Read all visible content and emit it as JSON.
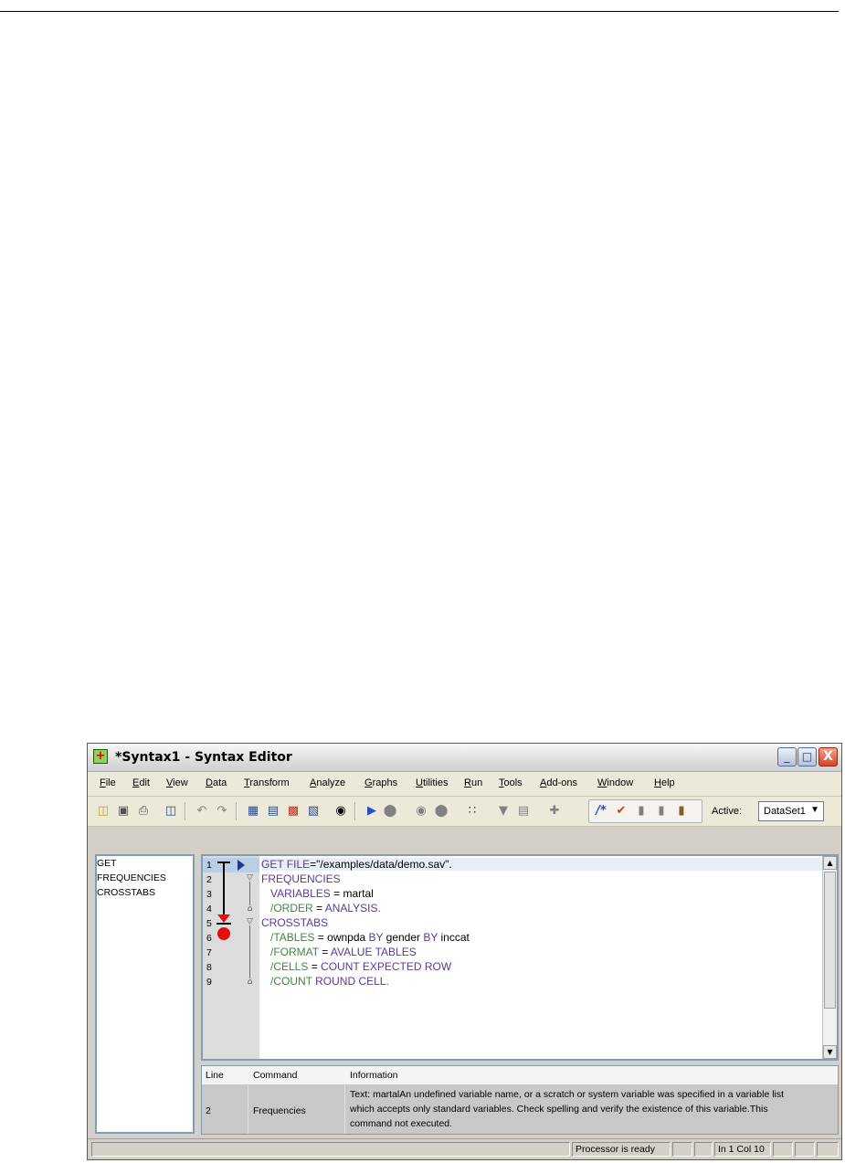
{
  "window": {
    "title": "*Syntax1 - Syntax Editor",
    "controls": {
      "minimize": "_",
      "maximize": "□",
      "close": "X"
    }
  },
  "menu": [
    "File",
    "Edit",
    "View",
    "Data",
    "Transform",
    "Analyze",
    "Graphs",
    "Utilities",
    "Run",
    "Tools",
    "Add-ons",
    "Window",
    "Help"
  ],
  "toolbar": {
    "icons": [
      "open-icon",
      "save-icon",
      "print-icon",
      "dialog-recall-icon",
      "undo-icon",
      "redo-icon",
      "goto-case-icon",
      "goto-variable-icon",
      "variables-icon",
      "find-icon",
      "run-icon",
      "stop-icon",
      "breakpoint-icon",
      "bookmark-icon",
      "comment-icon",
      "spell-check-icon"
    ],
    "active_label": "Active:",
    "active_dataset": "DataSet1"
  },
  "navigator": {
    "items": [
      "GET",
      "FREQUENCIES",
      "CROSSTABS"
    ]
  },
  "editor": {
    "line_numbers": [
      "1",
      "2",
      "3",
      "4",
      "5",
      "6",
      "7",
      "8",
      "9"
    ],
    "lines": [
      {
        "a": "GET FILE",
        "b": "=\"/examples/data/demo.sav\"."
      },
      {
        "a": "FREQUENCIES"
      },
      {
        "a": "VARIABLES",
        "b": " = martal"
      },
      {
        "a": "/ORDER",
        "b": " = ",
        "c": "ANALYSIS."
      },
      {
        "a": "CROSSTABS"
      },
      {
        "a": "/TABLES",
        "b": " = ownpda ",
        "c": "BY",
        "d": " gender ",
        "e": "BY",
        "f": " inccat"
      },
      {
        "a": "/FORMAT",
        "b": " = ",
        "c": "AVALUE TABLES"
      },
      {
        "a": "/CELLS",
        "b": " = ",
        "c": "COUNT EXPECTED ROW"
      },
      {
        "a": "/COUNT",
        "b": " ",
        "c": "ROUND CELL."
      }
    ]
  },
  "errors": {
    "headers": [
      "Line",
      "Command",
      "Information"
    ],
    "rows": [
      {
        "line": "2",
        "command": "Frequencies",
        "info1": "Text: martalAn undefined variable name, or a scratch or system variable was specified in a variable list",
        "info2": "which accepts only standard variables.  Check spelling and verify the existence of this variable.This",
        "info3": "command not executed."
      }
    ]
  },
  "status": {
    "processor": "Processor is ready",
    "position": "In 1 Col 10"
  }
}
